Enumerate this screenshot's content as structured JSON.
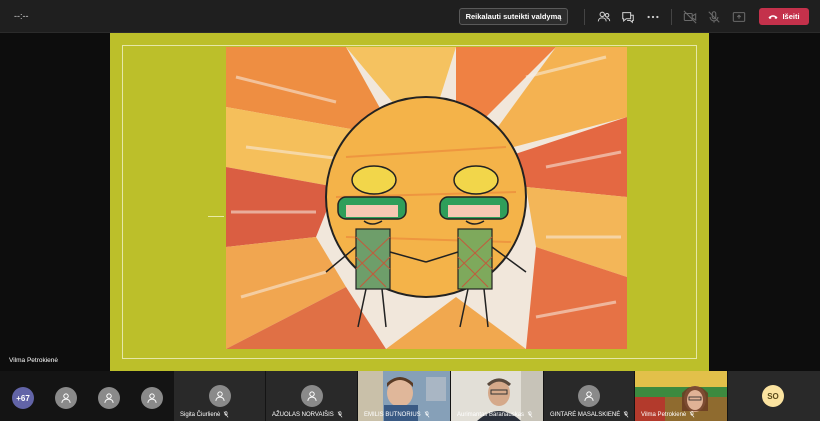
{
  "topbar": {
    "timer": "--:--",
    "request_control_label": "Reikalauti suteikti valdymą",
    "leave_label": "Išeiti",
    "icons": [
      "people-icon",
      "chat-icon",
      "more-icon",
      "camera-off-icon",
      "mic-off-icon",
      "share-tray-icon",
      "hang-up-icon"
    ]
  },
  "stage": {
    "presenter_name": "Vilma Petrokienė"
  },
  "participants": {
    "overflow_count": "+67",
    "tiles": [
      {
        "name": "Sigita Čiurlienė",
        "type": "avatar"
      },
      {
        "name": "AŽUOLAS NORVAIŠIS",
        "type": "avatar"
      },
      {
        "name": "EMILIS BUTNORIUS",
        "type": "video"
      },
      {
        "name": "Aurimantas Baranauskas",
        "type": "video"
      },
      {
        "name": "GINTARĖ MASALSKIENĖ",
        "type": "avatar"
      },
      {
        "name": "Vilma Petrokienė",
        "type": "video"
      }
    ],
    "initials_tile": "SO"
  },
  "colors": {
    "leave": "#c4314b",
    "slide_bg": "#bcbf2a",
    "initials_bg": "#fbe3a0"
  }
}
